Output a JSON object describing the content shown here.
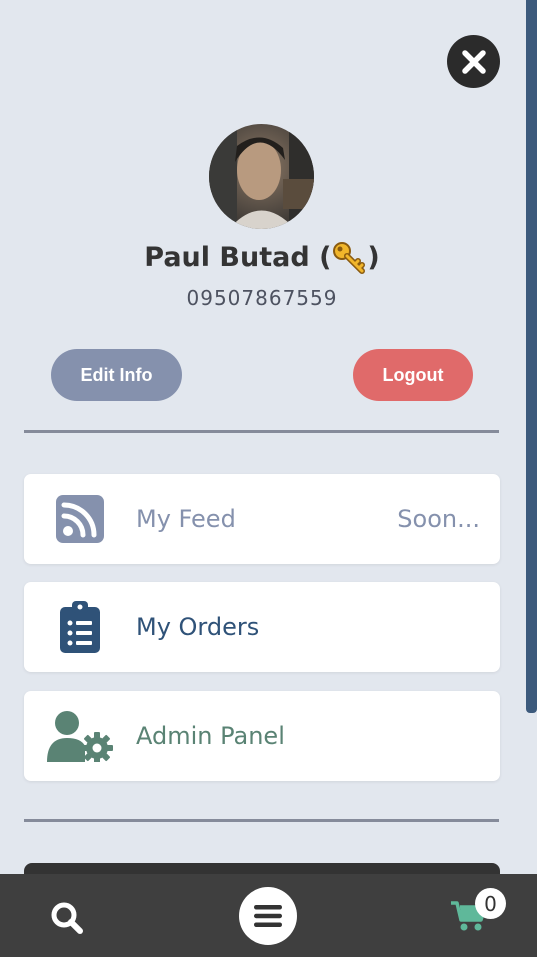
{
  "profile": {
    "name": "Paul Butad (",
    "name_suffix": ")",
    "phone": "09507867559"
  },
  "actions": {
    "edit_label": "Edit Info",
    "logout_label": "Logout"
  },
  "menu": [
    {
      "label": "My Feed",
      "badge": "Soon...",
      "icon": "rss-icon",
      "color": "#8591ad"
    },
    {
      "label": "My Orders",
      "icon": "clipboard-list-icon",
      "color": "#2f5278"
    },
    {
      "label": "Admin Panel",
      "icon": "user-cog-icon",
      "color": "#5a8374"
    }
  ],
  "bottom_nav": {
    "cart_count": "0",
    "cart_color": "#5fb89a"
  },
  "colors": {
    "background": "#e2e7ee",
    "edit_button": "#8591ad",
    "logout_button": "#e06a6a",
    "bottom_bar": "#3f3f3f"
  }
}
